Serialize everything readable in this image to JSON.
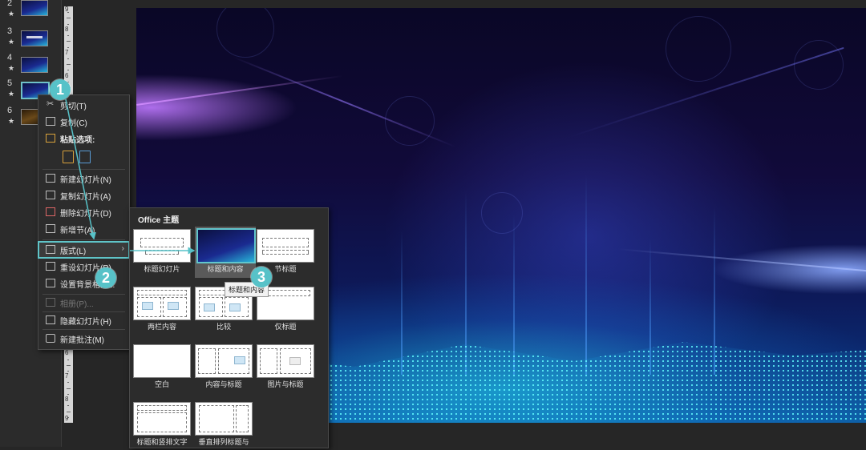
{
  "thumbnails": [
    {
      "number": "2",
      "star": "★"
    },
    {
      "number": "3",
      "star": "★"
    },
    {
      "number": "4",
      "star": "★"
    },
    {
      "number": "5",
      "star": "★"
    },
    {
      "number": "6",
      "star": "★"
    }
  ],
  "ruler": {
    "labels": [
      "9",
      "8",
      "7",
      "6",
      "5",
      "4",
      "3",
      "2",
      "1",
      "0",
      "1",
      "2",
      "3",
      "4",
      "5",
      "6",
      "7",
      "8",
      "9"
    ]
  },
  "context_menu": {
    "cut": "剪切(T)",
    "copy": "复制(C)",
    "paste_options": "粘贴选项:",
    "new_slide": "新建幻灯片(N)",
    "duplicate_slide": "复制幻灯片(A)",
    "delete_slide": "删除幻灯片(D)",
    "new_section": "新增节(A)",
    "layout": "版式(L)",
    "reset_slide": "重设幻灯片(R)",
    "format_background": "设置背景格式...",
    "photo_album": "相册(P)...",
    "hide_slide": "隐藏幻灯片(H)",
    "new_comment": "新建批注(M)"
  },
  "layout_gallery": {
    "header": "Office 主题",
    "items": [
      "标题幻灯片",
      "标题和内容",
      "节标题",
      "两栏内容",
      "比较",
      "仅标题",
      "空白",
      "内容与标题",
      "图片与标题",
      "标题和竖排文字",
      "垂直排列标题与"
    ],
    "selected_index": 1,
    "tooltip": "标题和内容"
  },
  "callouts": [
    "1",
    "2",
    "3"
  ],
  "colors": {
    "accent": "#57c2c8",
    "menu_bg": "#2c2c2c",
    "app_bg": "#262626"
  }
}
